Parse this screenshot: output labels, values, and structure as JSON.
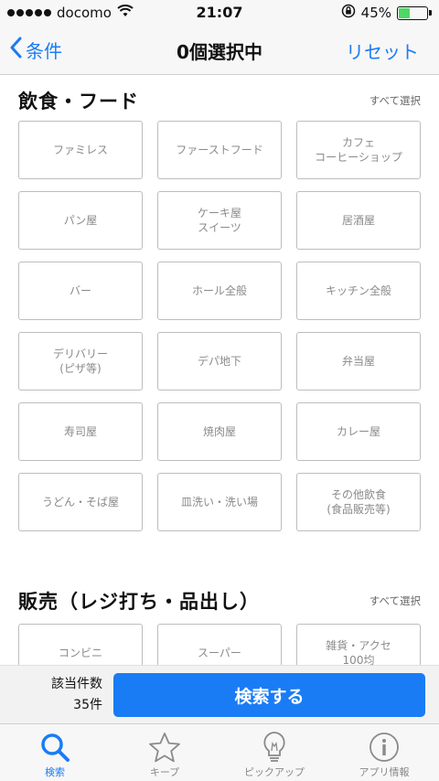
{
  "status_bar": {
    "carrier": "docomo",
    "time": "21:07",
    "battery": "45%",
    "battery_level": 0.45
  },
  "nav": {
    "back_label": "条件",
    "title": "0個選択中",
    "reset_label": "リセット"
  },
  "sections": [
    {
      "title": "飲食・フード",
      "select_all": "すべて選択",
      "items": [
        "ファミレス",
        "ファーストフード",
        "カフェ\nコーヒーショップ",
        "パン屋",
        "ケーキ屋\nスイーツ",
        "居酒屋",
        "バー",
        "ホール全般",
        "キッチン全般",
        "デリバリー\n(ピザ等)",
        "デパ地下",
        "弁当屋",
        "寿司屋",
        "焼肉屋",
        "カレー屋",
        "うどん・そば屋",
        "皿洗い・洗い場",
        "その他飲食\n(食品販売等)"
      ]
    },
    {
      "title": "販売（レジ打ち・品出し）",
      "select_all": "すべて選択",
      "items": [
        "コンビニ",
        "スーパー",
        "雑貨・アクセ\n100均"
      ]
    }
  ],
  "search": {
    "count_label": "該当件数",
    "count_value": "35件",
    "button_label": "検索する"
  },
  "tabs": [
    {
      "label": "検索",
      "icon": "search-icon",
      "active": true
    },
    {
      "label": "キープ",
      "icon": "star-icon",
      "active": false
    },
    {
      "label": "ピックアップ",
      "icon": "lightbulb-icon",
      "active": false
    },
    {
      "label": "アプリ情報",
      "icon": "info-icon",
      "active": false
    }
  ],
  "colors": {
    "accent": "#1a7cf5",
    "battery": "#4cd964",
    "border": "#bdbdbd",
    "inactive_text": "#8a8a8a"
  }
}
